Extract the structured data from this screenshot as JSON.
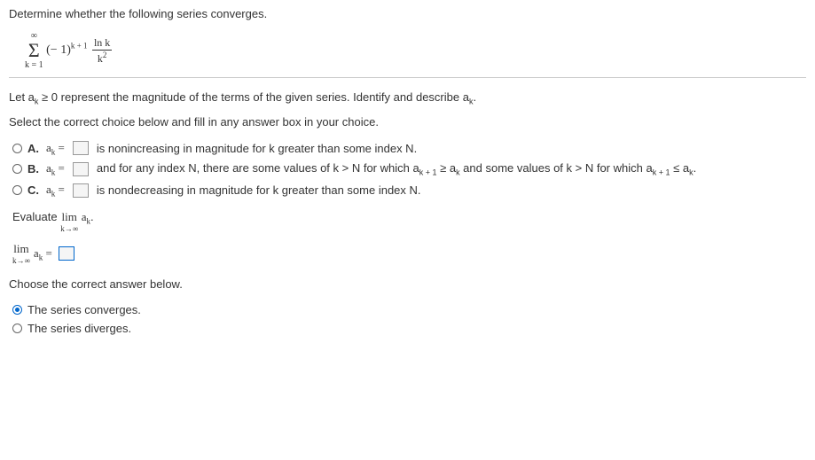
{
  "question": "Determine whether the following series converges.",
  "formula": {
    "sigma_top": "∞",
    "sigma_bottom": "k = 1",
    "term_base": "(− 1)",
    "term_exp": "k + 1",
    "frac_num": "ln k",
    "frac_den_base": "k",
    "frac_den_exp": "2"
  },
  "instruction": {
    "prefix": "Let a",
    "sub1": "k",
    "mid": " ≥ 0 represent the magnitude of the terms of the given series. Identify and describe a",
    "sub2": "k",
    "suffix": "."
  },
  "select_text": "Select the correct choice below and fill in any answer box in your choice.",
  "options": {
    "A": {
      "label": "A.",
      "ak_prefix": "a",
      "ak_sub": "k",
      "equals": " = ",
      "text": "is nonincreasing in magnitude for k greater than some index N."
    },
    "B": {
      "label": "B.",
      "ak_prefix": "a",
      "ak_sub": "k",
      "equals": " = ",
      "text_part1": "and for any index N, there are some values of k > N for which a",
      "sub_kp1_a": "k + 1",
      "geq": " ≥ a",
      "sub_k_a": "k",
      "text_part2": " and some values of k > N for which a",
      "sub_kp1_b": "k + 1",
      "leq": " ≤ a",
      "sub_k_b": "k",
      "text_end": "."
    },
    "C": {
      "label": "C.",
      "ak_prefix": "a",
      "ak_sub": "k",
      "equals": " = ",
      "text": "is nondecreasing in magnitude for k greater than some index N."
    }
  },
  "evaluate": {
    "prefix": "Evaluate ",
    "lim": "lim",
    "lim_sub": "k→∞",
    "ak": "a",
    "ak_sub": "k",
    "suffix": "."
  },
  "limit_answer": {
    "lim": "lim",
    "lim_sub": "k→∞",
    "ak": "a",
    "ak_sub": "k",
    "equals": " = "
  },
  "choose_text": "Choose the correct answer below.",
  "final": {
    "converges": "The series converges.",
    "diverges": "The series diverges."
  }
}
